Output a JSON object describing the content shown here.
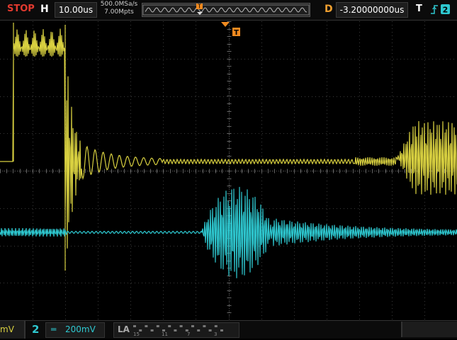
{
  "topbar": {
    "run_state": "STOP",
    "h_label": "H",
    "timebase": "10.00us",
    "sample_rate": "500.0MSa/s",
    "memory_depth": "7.00Mpts",
    "trigger_pos_marker": "T",
    "d_label": "D",
    "delay": "-3.20000000us",
    "t_label": "T",
    "trigger_icon": "rising-edge-icon",
    "trigger_source": "2"
  },
  "screen": {
    "trigger_marker": "T",
    "colors": {
      "ch1": "#d8d040",
      "ch2": "#2ec8d0",
      "grid": "#3c3c3c",
      "trigger": "#f08a20"
    }
  },
  "bottombar": {
    "ch1_scale_partial": "mV",
    "ch2_number": "2",
    "ch2_coupling": "═",
    "ch2_scale": "200mV",
    "la_label": "LA",
    "la_channels": [
      "15",
      "11",
      "7",
      "3"
    ]
  }
}
